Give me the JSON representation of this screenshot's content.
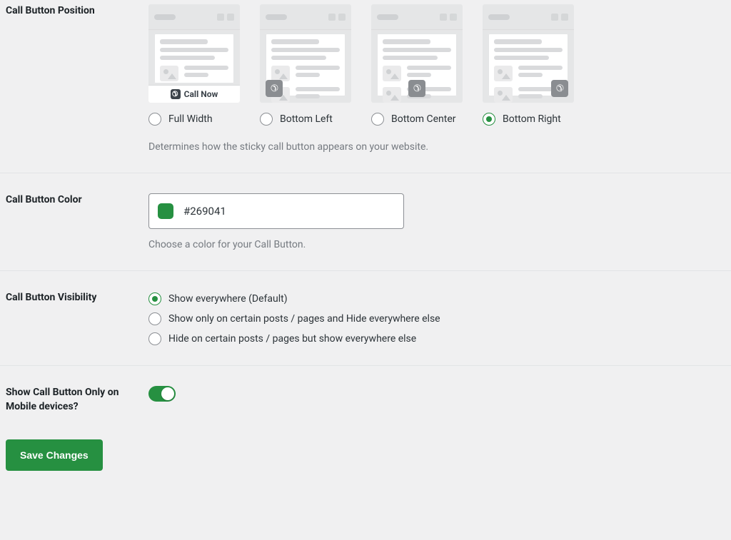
{
  "position": {
    "label": "Call Button Position",
    "options": [
      {
        "key": "full",
        "label": "Full Width",
        "overlay_text": "Call Now"
      },
      {
        "key": "left",
        "label": "Bottom Left"
      },
      {
        "key": "center",
        "label": "Bottom Center"
      },
      {
        "key": "right",
        "label": "Bottom Right"
      }
    ],
    "selected": "right",
    "helper": "Determines how the sticky call button appears on your website."
  },
  "color": {
    "label": "Call Button Color",
    "value": "#269041",
    "helper": "Choose a color for your Call Button."
  },
  "visibility": {
    "label": "Call Button Visibility",
    "options": [
      {
        "key": "everywhere",
        "label": "Show everywhere (Default)"
      },
      {
        "key": "show_certain",
        "label": "Show only on certain posts / pages and Hide everywhere else"
      },
      {
        "key": "hide_certain",
        "label": "Hide on certain posts / pages but show everywhere else"
      }
    ],
    "selected": "everywhere"
  },
  "mobile_only": {
    "label": "Show Call Button Only on Mobile devices?",
    "value": true
  },
  "save_label": "Save Changes"
}
